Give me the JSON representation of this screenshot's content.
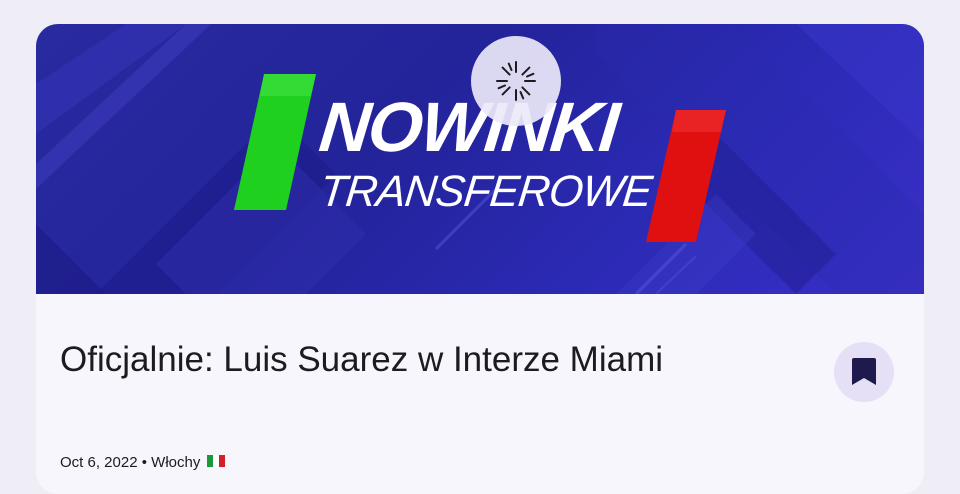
{
  "article": {
    "banner": {
      "brand_line1": "NOWINKI",
      "brand_line2": "TRANSFEROWE",
      "colors": {
        "background": "#2a2aa0",
        "green_bar": "#1fd01f",
        "red_bar": "#e01010",
        "text": "#ffffff"
      }
    },
    "loading_indicator": "spinner-icon",
    "title": "Oficjalnie: Luis Suarez w Interze Miami",
    "bookmark_icon": "bookmark-icon",
    "meta": {
      "date": "Oct 6, 2022",
      "separator": "•",
      "category": "Włochy",
      "flag": "italy-flag-icon"
    }
  }
}
